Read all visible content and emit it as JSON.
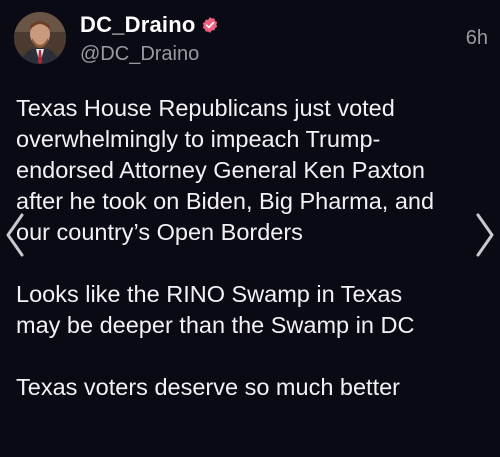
{
  "post": {
    "author": {
      "display_name": "DC_Draino",
      "handle": "@DC_Draino",
      "avatar_icon": "profile-photo",
      "badge_icon": "verified-badge-icon",
      "badge_color": "#ef5f7f"
    },
    "timestamp": "6h",
    "paragraphs": [
      "Texas House Republicans just voted\noverwhelmingly to impeach Trump-\nendorsed Attorney General Ken Paxton\nafter he took on Biden, Big Pharma, and\nour country’s Open Borders",
      "Looks like the RINO Swamp in Texas\nmay be deeper than the Swamp in DC",
      "Texas voters deserve so much better"
    ]
  },
  "navigation": {
    "previous_icon": "chevron-left-icon",
    "next_icon": "chevron-right-icon"
  },
  "colors": {
    "background": "#0a0a14",
    "text": "#f2f2f4",
    "muted": "#9a9aa2"
  }
}
